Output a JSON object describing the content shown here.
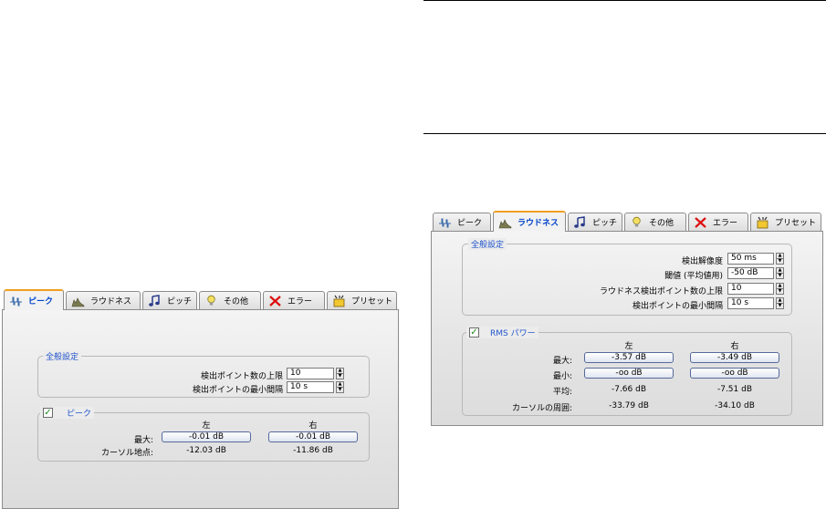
{
  "tabs": {
    "peak": "ピーク",
    "loudness": "ラウドネス",
    "pitch": "ピッチ",
    "other": "その他",
    "error": "エラー",
    "preset": "プリセット"
  },
  "peak_panel": {
    "active_tab": "peak",
    "general_group": {
      "title": "全般設定",
      "max_points_label": "検出ポイント数の上限",
      "max_points_value": "10",
      "min_interval_label": "検出ポイントの最小間隔",
      "min_interval_value": "10 s"
    },
    "peak_group": {
      "title": "ピーク",
      "checked": true,
      "left_header": "左",
      "right_header": "右",
      "max_label": "最大:",
      "max_left": "-0.01 dB",
      "max_right": "-0.01 dB",
      "cursor_label": "カーソル地点:",
      "cursor_left": "-12.03 dB",
      "cursor_right": "-11.86 dB"
    }
  },
  "loudness_panel": {
    "active_tab": "loudness",
    "general_group": {
      "title": "全般設定",
      "resolution_label": "検出解像度",
      "resolution_value": "50 ms",
      "threshold_label": "閾値 (平均値用)",
      "threshold_value": "-50 dB",
      "max_points_label": "ラウドネス検出ポイント数の上限",
      "max_points_value": "10",
      "min_interval_label": "検出ポイントの最小間隔",
      "min_interval_value": "10 s"
    },
    "rms_group": {
      "title": "RMS パワー",
      "checked": true,
      "left_header": "左",
      "right_header": "右",
      "max_label": "最大:",
      "max_left": "-3.57 dB",
      "max_right": "-3.49 dB",
      "min_label": "最小:",
      "min_left": "-oo dB",
      "min_right": "-oo dB",
      "avg_label": "平均:",
      "avg_left": "-7.66 dB",
      "avg_right": "-7.51 dB",
      "cursor_label": "カーソルの周囲:",
      "cursor_left": "-33.79 dB",
      "cursor_right": "-34.10 dB"
    }
  },
  "colors": {
    "active_tab_text": "#0044cc",
    "active_tab_accent": "#f0a020",
    "group_title": "#2255cc",
    "checkbox_mark": "#1a8a1a"
  },
  "icons": {
    "peak": "peak-waveform-icon",
    "loudness": "loudness-graph-icon",
    "pitch": "music-note-icon",
    "other": "lightbulb-icon",
    "error": "red-x-icon",
    "preset": "preset-icon"
  }
}
